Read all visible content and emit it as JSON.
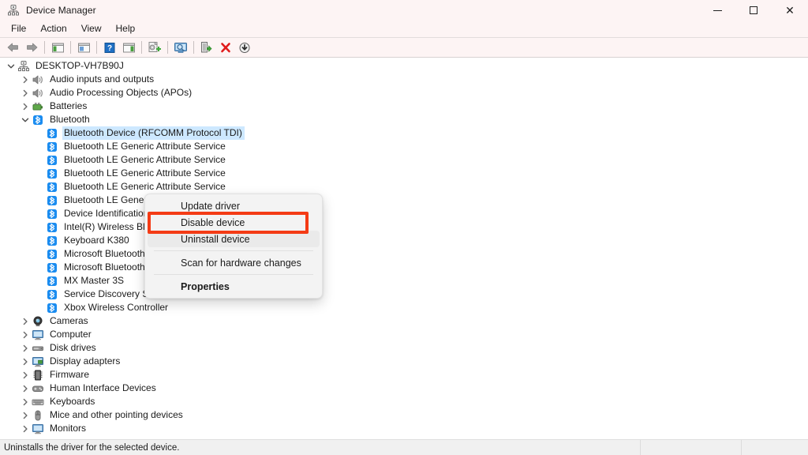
{
  "window": {
    "title": "Device Manager",
    "icon": "device-manager-icon",
    "controls": {
      "minimize": "─",
      "maximize": "□",
      "close": "✕"
    }
  },
  "menubar": {
    "items": [
      "File",
      "Action",
      "View",
      "Help"
    ]
  },
  "toolbar": {
    "buttons": [
      {
        "name": "back-arrow-icon",
        "tip": "Back"
      },
      {
        "name": "forward-arrow-icon",
        "tip": "Forward"
      },
      {
        "name": "show-hide-console-tree-icon",
        "tip": "Show/Hide Console Tree"
      },
      {
        "name": "properties-icon",
        "tip": "Properties"
      },
      {
        "name": "help-icon",
        "tip": "Help"
      },
      {
        "name": "show-hide-action-pane-icon",
        "tip": "Show/Hide Action Pane"
      },
      {
        "name": "update-driver-icon",
        "tip": "Update driver"
      },
      {
        "name": "scan-for-hardware-changes-icon",
        "tip": "Scan for hardware changes"
      },
      {
        "name": "enable-device-icon",
        "tip": "Enable device"
      },
      {
        "name": "uninstall-device-icon",
        "tip": "Uninstall device"
      },
      {
        "name": "disable-device-icon",
        "tip": "Disable device"
      }
    ]
  },
  "tree": {
    "root": {
      "label": "DESKTOP-VH7B90J",
      "icon": "computer-icon",
      "expanded": true
    },
    "nodes": [
      {
        "label": "Audio inputs and outputs",
        "icon": "speaker-icon",
        "level": 1,
        "expanded": false,
        "expandable": true
      },
      {
        "label": "Audio Processing Objects (APOs)",
        "icon": "speaker-icon",
        "level": 1,
        "expanded": false,
        "expandable": true
      },
      {
        "label": "Batteries",
        "icon": "battery-icon",
        "level": 1,
        "expanded": false,
        "expandable": true
      },
      {
        "label": "Bluetooth",
        "icon": "bluetooth-icon",
        "level": 1,
        "expanded": true,
        "expandable": true
      },
      {
        "label": "Bluetooth Device (RFCOMM Protocol TDI)",
        "icon": "bluetooth-icon",
        "level": 2,
        "expandable": false,
        "selected": true
      },
      {
        "label": "Bluetooth LE Generic Attribute Service",
        "icon": "bluetooth-icon",
        "level": 2,
        "expandable": false
      },
      {
        "label": "Bluetooth LE Generic Attribute Service",
        "icon": "bluetooth-icon",
        "level": 2,
        "expandable": false
      },
      {
        "label": "Bluetooth LE Generic Attribute Service",
        "icon": "bluetooth-icon",
        "level": 2,
        "expandable": false
      },
      {
        "label": "Bluetooth LE Generic Attribute Service",
        "icon": "bluetooth-icon",
        "level": 2,
        "expandable": false
      },
      {
        "label": "Bluetooth LE Generic Attribute Service",
        "icon": "bluetooth-icon",
        "level": 2,
        "expandable": false
      },
      {
        "label": "Device Identification Service",
        "icon": "bluetooth-icon",
        "level": 2,
        "expandable": false
      },
      {
        "label": "Intel(R) Wireless Bluetooth(R)",
        "icon": "bluetooth-icon",
        "level": 2,
        "expandable": false
      },
      {
        "label": "Keyboard K380",
        "icon": "bluetooth-icon",
        "level": 2,
        "expandable": false
      },
      {
        "label": "Microsoft Bluetooth Enumerator",
        "icon": "bluetooth-icon",
        "level": 2,
        "expandable": false
      },
      {
        "label": "Microsoft Bluetooth LE Enumerator",
        "icon": "bluetooth-icon",
        "level": 2,
        "expandable": false
      },
      {
        "label": "MX Master 3S",
        "icon": "bluetooth-icon",
        "level": 2,
        "expandable": false
      },
      {
        "label": "Service Discovery Service",
        "icon": "bluetooth-icon",
        "level": 2,
        "expandable": false
      },
      {
        "label": "Xbox Wireless Controller",
        "icon": "bluetooth-icon",
        "level": 2,
        "expandable": false
      },
      {
        "label": "Cameras",
        "icon": "camera-icon",
        "level": 1,
        "expanded": false,
        "expandable": true
      },
      {
        "label": "Computer",
        "icon": "monitor-icon",
        "level": 1,
        "expanded": false,
        "expandable": true
      },
      {
        "label": "Disk drives",
        "icon": "disk-icon",
        "level": 1,
        "expanded": false,
        "expandable": true
      },
      {
        "label": "Display adapters",
        "icon": "display-adapter-icon",
        "level": 1,
        "expanded": false,
        "expandable": true
      },
      {
        "label": "Firmware",
        "icon": "firmware-chip-icon",
        "level": 1,
        "expanded": false,
        "expandable": true
      },
      {
        "label": "Human Interface Devices",
        "icon": "hid-icon",
        "level": 1,
        "expanded": false,
        "expandable": true
      },
      {
        "label": "Keyboards",
        "icon": "keyboard-icon",
        "level": 1,
        "expanded": false,
        "expandable": true
      },
      {
        "label": "Mice and other pointing devices",
        "icon": "mouse-icon",
        "level": 1,
        "expanded": false,
        "expandable": true
      },
      {
        "label": "Monitors",
        "icon": "monitor-icon",
        "level": 1,
        "expanded": false,
        "expandable": true
      }
    ],
    "chevron_collapsed": "›",
    "chevron_expanded": "⌄"
  },
  "context_menu": {
    "items": [
      {
        "label": "Update driver",
        "bold": false,
        "hover": false
      },
      {
        "label": "Disable device",
        "bold": false,
        "hover": false,
        "highlighted": true
      },
      {
        "label": "Uninstall device",
        "bold": false,
        "hover": true
      },
      {
        "label": "Scan for hardware changes",
        "bold": false,
        "hover": false
      },
      {
        "label": "Properties",
        "bold": true,
        "hover": false
      }
    ],
    "highlight_color": "#f43b15"
  },
  "statusbar": {
    "message": "Uninstalls the driver for the selected device.",
    "pane2": "",
    "pane3": ""
  },
  "colors": {
    "titlebar_bg": "#fdf4f4",
    "selection_blue": "#cde8ff",
    "bluetooth_blue": "#0a84ff",
    "annotation_red": "#f43b15",
    "status_bg": "#f0f0f0"
  }
}
